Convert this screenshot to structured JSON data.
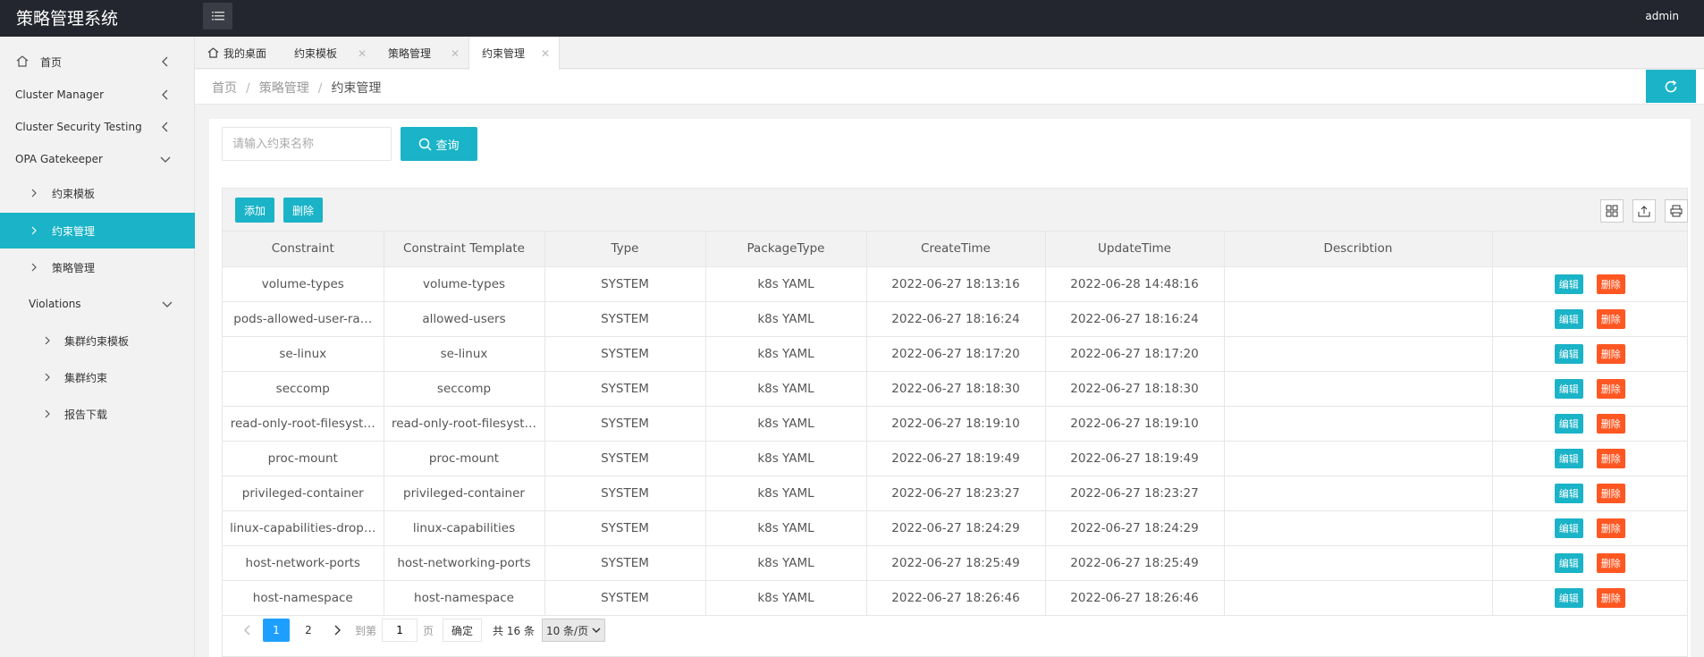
{
  "app": {
    "title": "策略管理系统",
    "user": "admin"
  },
  "sidebar": {
    "items": [
      {
        "label": "首页"
      },
      {
        "label": "Cluster Manager"
      },
      {
        "label": "Cluster Security Testing"
      },
      {
        "label": "OPA Gatekeeper"
      },
      {
        "label": "约束模板"
      },
      {
        "label": "约束管理"
      },
      {
        "label": "策略管理"
      },
      {
        "label": "Violations"
      },
      {
        "label": "集群约束模板"
      },
      {
        "label": "集群约束"
      },
      {
        "label": "报告下载"
      }
    ]
  },
  "tabs": [
    {
      "label": "我的桌面"
    },
    {
      "label": "约束模板"
    },
    {
      "label": "策略管理"
    },
    {
      "label": "约束管理"
    }
  ],
  "breadcrumb": [
    "首页",
    "策略管理",
    "约束管理"
  ],
  "search": {
    "placeholder": "请输入约束名称",
    "button": "查询"
  },
  "toolbar": {
    "add": "添加",
    "delete": "删除"
  },
  "table": {
    "headers": [
      "Constraint",
      "Constraint Template",
      "Type",
      "PackageType",
      "CreateTime",
      "UpdateTime",
      "Describtion",
      ""
    ],
    "rows": [
      [
        "volume-types",
        "volume-types",
        "SYSTEM",
        "k8s YAML",
        "2022-06-27 18:13:16",
        "2022-06-28 14:48:16",
        ""
      ],
      [
        "pods-allowed-user-ra…",
        "allowed-users",
        "SYSTEM",
        "k8s YAML",
        "2022-06-27 18:16:24",
        "2022-06-27 18:16:24",
        ""
      ],
      [
        "se-linux",
        "se-linux",
        "SYSTEM",
        "k8s YAML",
        "2022-06-27 18:17:20",
        "2022-06-27 18:17:20",
        ""
      ],
      [
        "seccomp",
        "seccomp",
        "SYSTEM",
        "k8s YAML",
        "2022-06-27 18:18:30",
        "2022-06-27 18:18:30",
        ""
      ],
      [
        "read-only-root-filesyst…",
        "read-only-root-filesyst…",
        "SYSTEM",
        "k8s YAML",
        "2022-06-27 18:19:10",
        "2022-06-27 18:19:10",
        ""
      ],
      [
        "proc-mount",
        "proc-mount",
        "SYSTEM",
        "k8s YAML",
        "2022-06-27 18:19:49",
        "2022-06-27 18:19:49",
        ""
      ],
      [
        "privileged-container",
        "privileged-container",
        "SYSTEM",
        "k8s YAML",
        "2022-06-27 18:23:27",
        "2022-06-27 18:23:27",
        ""
      ],
      [
        "linux-capabilities-drop…",
        "linux-capabilities",
        "SYSTEM",
        "k8s YAML",
        "2022-06-27 18:24:29",
        "2022-06-27 18:24:29",
        ""
      ],
      [
        "host-network-ports",
        "host-networking-ports",
        "SYSTEM",
        "k8s YAML",
        "2022-06-27 18:25:49",
        "2022-06-27 18:25:49",
        ""
      ],
      [
        "host-namespace",
        "host-namespace",
        "SYSTEM",
        "k8s YAML",
        "2022-06-27 18:26:46",
        "2022-06-27 18:26:46",
        ""
      ]
    ],
    "row_actions": {
      "edit": "编辑",
      "delete": "删除"
    }
  },
  "pager": {
    "pages": [
      "1",
      "2"
    ],
    "current": "1",
    "goto_label": "到第",
    "goto_value": "1",
    "page_unit": "页",
    "ok": "确定",
    "total": "共 16 条",
    "page_size": "10 条/页"
  },
  "colors": {
    "accent": "#1ab3c7",
    "danger": "#ff5722",
    "header": "#23262e",
    "pager_current": "#1e9fff"
  }
}
